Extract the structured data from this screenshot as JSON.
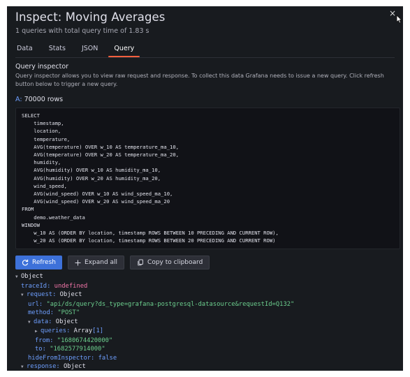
{
  "modal": {
    "title": "Inspect: Moving Averages",
    "subtitle": "1 queries with total query time of 1.83 s",
    "close_glyph": "×"
  },
  "tabs": [
    {
      "label": "Data"
    },
    {
      "label": "Stats"
    },
    {
      "label": "JSON"
    },
    {
      "label": "Query",
      "active": true
    }
  ],
  "inspector": {
    "title": "Query inspector",
    "description": "Query inspector allows you to view raw request and response. To collect this data Grafana needs to issue a new query. Click refresh button below to trigger a new query."
  },
  "query": {
    "ref": "A:",
    "rows": "70000 rows",
    "sql": "SELECT\n    timestamp,\n    location,\n    temperature,\n    AVG(temperature) OVER w_10 AS temperature_ma_10,\n    AVG(temperature) OVER w_20 AS temperature_ma_20,\n    humidity,\n    AVG(humidity) OVER w_10 AS humidity_ma_10,\n    AVG(humidity) OVER w_20 AS humidity_ma_20,\n    wind_speed,\n    AVG(wind_speed) OVER w_10 AS wind_speed_ma_10,\n    AVG(wind_speed) OVER w_20 AS wind_speed_ma_20\nFROM\n    demo.weather_data\nWINDOW\n    w_10 AS (ORDER BY location, timestamp ROWS BETWEEN 10 PRECEDING AND CURRENT ROW),\n    w_20 AS (ORDER BY location, timestamp ROWS BETWEEN 20 PRECEDING AND CURRENT ROW)"
  },
  "buttons": {
    "refresh": "Refresh",
    "expand": "Expand all",
    "copy": "Copy to clipboard"
  },
  "json_tree": {
    "root": "Object",
    "traceId_key": "traceId:",
    "traceId_val": "undefined",
    "request_key": "request:",
    "request_val": "Object",
    "url_key": "url:",
    "url_val": "\"api/ds/query?ds_type=grafana-postgresql-datasource&requestId=Q132\"",
    "method_key": "method:",
    "method_val": "\"POST\"",
    "data_key": "data:",
    "data_val": "Object",
    "queries_key": "queries:",
    "queries_val": "Array",
    "queries_count": "[1]",
    "from_key": "from:",
    "from_val": "\"1680674420000\"",
    "to_key": "to:",
    "to_val": "\"1682577914000\"",
    "hide_key": "hideFromInspector:",
    "hide_val": "false",
    "response_key": "response:",
    "response_val": "Object"
  },
  "colors": {
    "background": "#181b1f",
    "accent_tab": "#f55f3e",
    "primary_button": "#3d71d9",
    "json_key": "#6e9fff",
    "json_string": "#6ccf8e",
    "json_undefined": "#f275a8"
  }
}
